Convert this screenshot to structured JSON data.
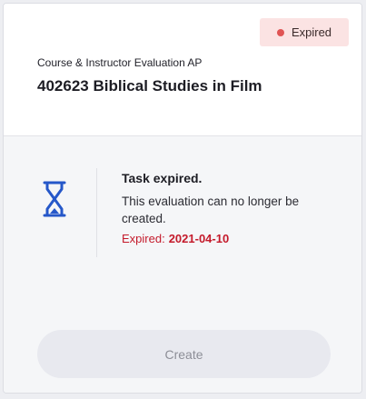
{
  "header": {
    "status_badge": "Expired",
    "subtitle": "Course & Instructor Evaluation AP",
    "title": "402623 Biblical Studies in Film"
  },
  "task": {
    "icon": "hourglass-icon",
    "title": "Task expired.",
    "description": "This evaluation can no longer be created.",
    "expired_label": "Expired:",
    "expired_date": "2021-04-10"
  },
  "actions": {
    "create_label": "Create"
  },
  "colors": {
    "accent_blue": "#2557c9",
    "expired_red": "#c41a2b",
    "badge_bg": "#fbe3e3",
    "badge_dot": "#e05454"
  }
}
